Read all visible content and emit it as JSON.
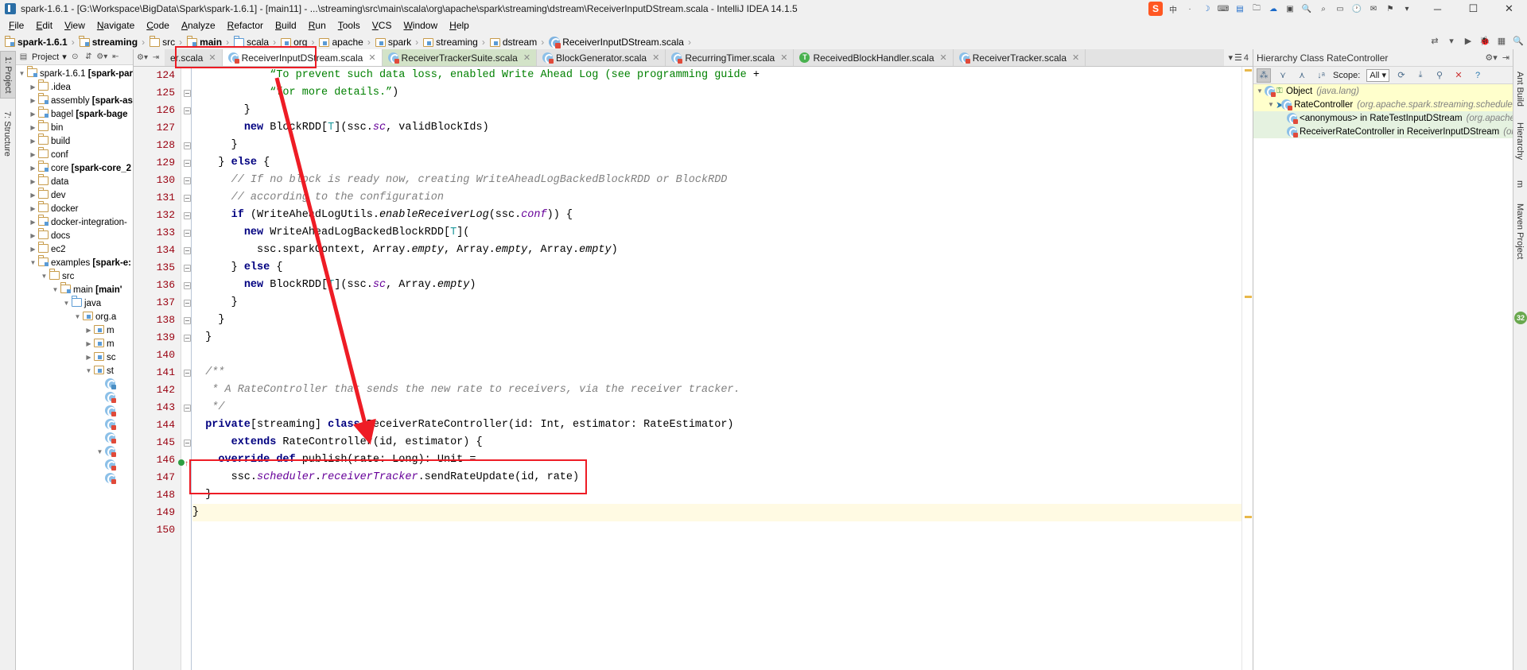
{
  "window": {
    "title": "spark-1.6.1 - [G:\\Workspace\\BigData\\Spark\\spark-1.6.1] - [main11] - ...\\streaming\\src\\main\\scala\\org\\apache\\spark\\streaming\\dstream\\ReceiverInputDStream.scala - IntelliJ IDEA 14.1.5",
    "minimize": "─",
    "maximize": "☐",
    "close": "✕"
  },
  "tray": {
    "sogou": "S",
    "items": [
      "中",
      "·",
      "◐",
      "✎",
      "⌨",
      "▤",
      "▶",
      "☁",
      "⚡",
      "⬇",
      "⚙",
      "◉",
      "✉",
      "⚑",
      "▭",
      "▾"
    ]
  },
  "menu": [
    "File",
    "Edit",
    "View",
    "Navigate",
    "Code",
    "Analyze",
    "Refactor",
    "Build",
    "Run",
    "Tools",
    "VCS",
    "Window",
    "Help"
  ],
  "breadcrumb": [
    {
      "label": "spark-1.6.1",
      "icon": "folder-module-icon",
      "bold": true
    },
    {
      "label": "streaming",
      "icon": "folder-module-icon",
      "bold": true
    },
    {
      "label": "src",
      "icon": "folder-icon",
      "bold": false
    },
    {
      "label": "main",
      "icon": "folder-module-icon",
      "bold": true
    },
    {
      "label": "scala",
      "icon": "folder-source-icon",
      "bold": false
    },
    {
      "label": "org",
      "icon": "package-icon",
      "bold": false
    },
    {
      "label": "apache",
      "icon": "package-icon",
      "bold": false
    },
    {
      "label": "spark",
      "icon": "package-icon",
      "bold": false
    },
    {
      "label": "streaming",
      "icon": "package-icon",
      "bold": false
    },
    {
      "label": "dstream",
      "icon": "package-icon",
      "bold": false
    },
    {
      "label": "ReceiverInputDStream.scala",
      "icon": "scala-class-icon",
      "bold": false
    }
  ],
  "left_tool_strip": [
    {
      "label": "1: Project",
      "active": true
    },
    {
      "label": "7: Structure",
      "active": false
    }
  ],
  "right_tool_strip": [
    {
      "label": "Ant Build"
    },
    {
      "label": "Hierarchy"
    },
    {
      "label": "m"
    },
    {
      "label": "Maven Project"
    }
  ],
  "project_panel": {
    "toolbar": {
      "title": "Project",
      "dropdown": "▾",
      "icons": [
        "target-icon",
        "collapse-icon",
        "gear-icon",
        "hide-icon"
      ]
    },
    "tree": [
      {
        "depth": 0,
        "arrow": "▼",
        "icon": "folder-module-icon",
        "label": "spark-1.6.1 ",
        "bold": "[spark-par"
      },
      {
        "depth": 1,
        "arrow": "▶",
        "icon": "folder-icon",
        "label": ".idea",
        "bold": ""
      },
      {
        "depth": 1,
        "arrow": "▶",
        "icon": "folder-module-icon",
        "label": "assembly ",
        "bold": "[spark-as"
      },
      {
        "depth": 1,
        "arrow": "▶",
        "icon": "folder-module-icon",
        "label": "bagel ",
        "bold": "[spark-bage"
      },
      {
        "depth": 1,
        "arrow": "▶",
        "icon": "folder-icon",
        "label": "bin",
        "bold": ""
      },
      {
        "depth": 1,
        "arrow": "▶",
        "icon": "folder-icon",
        "label": "build",
        "bold": ""
      },
      {
        "depth": 1,
        "arrow": "▶",
        "icon": "folder-icon",
        "label": "conf",
        "bold": ""
      },
      {
        "depth": 1,
        "arrow": "▶",
        "icon": "folder-module-icon",
        "label": "core ",
        "bold": "[spark-core_2"
      },
      {
        "depth": 1,
        "arrow": "▶",
        "icon": "folder-icon",
        "label": "data",
        "bold": ""
      },
      {
        "depth": 1,
        "arrow": "▶",
        "icon": "folder-icon",
        "label": "dev",
        "bold": ""
      },
      {
        "depth": 1,
        "arrow": "▶",
        "icon": "folder-icon",
        "label": "docker",
        "bold": ""
      },
      {
        "depth": 1,
        "arrow": "▶",
        "icon": "folder-module-icon",
        "label": "docker-integration-",
        "bold": ""
      },
      {
        "depth": 1,
        "arrow": "▶",
        "icon": "folder-icon",
        "label": "docs",
        "bold": ""
      },
      {
        "depth": 1,
        "arrow": "▶",
        "icon": "folder-icon",
        "label": "ec2",
        "bold": ""
      },
      {
        "depth": 1,
        "arrow": "▼",
        "icon": "folder-module-icon",
        "label": "examples ",
        "bold": "[spark-e:"
      },
      {
        "depth": 2,
        "arrow": "▼",
        "icon": "folder-icon",
        "label": "src",
        "bold": ""
      },
      {
        "depth": 3,
        "arrow": "▼",
        "icon": "folder-module-icon",
        "label": "main ",
        "bold": "[main'"
      },
      {
        "depth": 4,
        "arrow": "▼",
        "icon": "folder-source-icon",
        "label": "java",
        "bold": ""
      },
      {
        "depth": 5,
        "arrow": "▼",
        "icon": "package-icon",
        "label": "org.a",
        "bold": ""
      },
      {
        "depth": 6,
        "arrow": "▶",
        "icon": "package-icon",
        "label": "m",
        "bold": ""
      },
      {
        "depth": 6,
        "arrow": "▶",
        "icon": "package-icon",
        "label": "m",
        "bold": ""
      },
      {
        "depth": 6,
        "arrow": "▶",
        "icon": "package-icon",
        "label": "sc",
        "bold": ""
      },
      {
        "depth": 6,
        "arrow": "▼",
        "icon": "package-icon",
        "label": "st",
        "bold": ""
      },
      {
        "depth": 7,
        "arrow": "",
        "icon": "scala-object-icon",
        "label": "",
        "bold": ""
      },
      {
        "depth": 7,
        "arrow": "",
        "icon": "scala-class-icon",
        "label": "",
        "bold": ""
      },
      {
        "depth": 7,
        "arrow": "",
        "icon": "scala-class-icon",
        "label": "",
        "bold": ""
      },
      {
        "depth": 7,
        "arrow": "",
        "icon": "scala-class-icon",
        "label": "",
        "bold": ""
      },
      {
        "depth": 7,
        "arrow": "",
        "icon": "scala-class-icon",
        "label": "",
        "bold": ""
      },
      {
        "depth": 7,
        "arrow": "▼",
        "icon": "scala-class-icon",
        "label": "",
        "bold": ""
      },
      {
        "depth": 7,
        "arrow": "",
        "icon": "scala-class-icon",
        "label": "",
        "bold": ""
      },
      {
        "depth": 7,
        "arrow": "",
        "icon": "scala-class-icon",
        "label": "",
        "bold": ""
      }
    ]
  },
  "editor_tabs": {
    "tools": [
      "gear-icon",
      "locate-icon"
    ],
    "tabs": [
      {
        "label": "er.scala",
        "state": "normal",
        "icon": "scala-class-icon",
        "close": "✕"
      },
      {
        "label": "ReceiverInputDStream.scala",
        "state": "selected",
        "icon": "scala-class-icon",
        "close": "✕"
      },
      {
        "label": "ReceiverTrackerSuite.scala",
        "state": "green",
        "icon": "scala-class-icon",
        "close": "✕"
      },
      {
        "label": "BlockGenerator.scala",
        "state": "normal",
        "icon": "scala-class-icon",
        "close": "✕"
      },
      {
        "label": "RecurringTimer.scala",
        "state": "normal",
        "icon": "scala-class-icon",
        "close": "✕"
      },
      {
        "label": "ReceivedBlockHandler.scala",
        "state": "normal",
        "icon": "scala-test-icon",
        "close": "✕"
      },
      {
        "label": "ReceiverTracker.scala",
        "state": "normal",
        "icon": "scala-class-icon",
        "close": "✕"
      }
    ],
    "overflow": {
      "arrow": "▾",
      "icon": "☰",
      "count": "4"
    }
  },
  "code": {
    "first_line": 124,
    "current_line": 149,
    "lines": [
      {
        "no": 124,
        "fold": "none",
        "html": "            <s>“To prevent such data loss, enabled Write Ahead Log (see programming guide </s>+"
      },
      {
        "no": 125,
        "fold": "end",
        "html": "            <s>“for more details.”</s>)"
      },
      {
        "no": 126,
        "fold": "end",
        "html": "        }"
      },
      {
        "no": 127,
        "fold": "none",
        "html": "        <k>new</k> BlockRDD[<t>T</t>](ssc.<f>sc</f>, validBlockIds)"
      },
      {
        "no": 128,
        "fold": "end",
        "html": "      }"
      },
      {
        "no": 129,
        "fold": "open",
        "html": "    } <k>else</k> {"
      },
      {
        "no": 130,
        "fold": "open",
        "html": "      <c>// If no block is ready now, creating WriteAheadLogBackedBlockRDD or BlockRDD</c>"
      },
      {
        "no": 131,
        "fold": "end",
        "html": "      <c>// according to the configuration</c>"
      },
      {
        "no": 132,
        "fold": "open",
        "html": "      <k>if</k> (WriteAheadLogUtils.<i>enableReceiverLog</i>(ssc.<f>conf</f>)) {"
      },
      {
        "no": 133,
        "fold": "open",
        "html": "        <k>new</k> WriteAheadLogBackedBlockRDD[<t>T</t>]("
      },
      {
        "no": 134,
        "fold": "end",
        "html": "          ssc.sparkContext, Array.<i>empty</i>, Array.<i>empty</i>, Array.<i>empty</i>)"
      },
      {
        "no": 135,
        "fold": "open",
        "html": "      } <k>else</k> {"
      },
      {
        "no": 136,
        "fold": "end",
        "html": "        <k>new</k> BlockRDD[<t>T</t>](ssc.<f>sc</f>, Array.<i>empty</i>)"
      },
      {
        "no": 137,
        "fold": "end",
        "html": "      }"
      },
      {
        "no": 138,
        "fold": "end",
        "html": "    }"
      },
      {
        "no": 139,
        "fold": "end",
        "html": "  }"
      },
      {
        "no": 140,
        "fold": "none",
        "html": ""
      },
      {
        "no": 141,
        "fold": "open",
        "html": "  <c>/**</c>"
      },
      {
        "no": 142,
        "fold": "none",
        "html": "   <c>* A RateController that sends the new rate to receivers, via the receiver tracker.</c>"
      },
      {
        "no": 143,
        "fold": "end",
        "html": "   <c>*/</c>"
      },
      {
        "no": 144,
        "fold": "none",
        "html": "  <k>private</k>[streaming] <k>class</k> ReceiverRateController(id: Int, estimator: RateEstimator)"
      },
      {
        "no": 145,
        "fold": "end",
        "html": "      <k>extends</k> RateController(id, estimator) {"
      },
      {
        "no": 146,
        "fold": "none",
        "html": "    <k>override def</k> publish(rate: Long): Unit ="
      },
      {
        "no": 147,
        "fold": "none",
        "html": "      ssc.<f>scheduler</f>.<f>receiverTracker</f>.sendRateUpdate(id, rate)"
      },
      {
        "no": 148,
        "fold": "none",
        "html": "  }"
      },
      {
        "no": 149,
        "fold": "none",
        "html": "}"
      },
      {
        "no": 150,
        "fold": "none",
        "html": ""
      }
    ]
  },
  "annotations": {
    "tab_highlight_box": true,
    "code_highlight_box": true,
    "arrow_color": "#ee1c25",
    "box_color": "#ee1c25"
  },
  "hierarchy": {
    "title": "Hierarchy Class RateController",
    "head_icons": [
      "gear-icon",
      "hide-icon"
    ],
    "toolbar": {
      "buttons": [
        "subtypes-hierarchy-icon",
        "supertypes-hierarchy-icon",
        "subtypes-icon",
        "sort-alpha-icon"
      ],
      "scope_label": "Scope:",
      "scope_value": "All",
      "scope_arrow": "▾",
      "refresh_icon": "refresh-icon",
      "export_icon": "export-icon",
      "pin_icon": "pin-icon",
      "close_icon": "✕",
      "help_icon": "?"
    },
    "rows": [
      {
        "indent": 0,
        "arrow": "▼",
        "icon": "java-class-icon",
        "lock": true,
        "name": "Object",
        "pkg": "(java.lang)",
        "bg": "yellow"
      },
      {
        "indent": 1,
        "arrow": "▼",
        "icon": "scala-class-icon",
        "pointer": true,
        "name": "RateController",
        "pkg": "(org.apache.spark.streaming.scheduler)",
        "bg": "yellow"
      },
      {
        "indent": 2,
        "arrow": "",
        "icon": "scala-class-icon",
        "name": "<anonymous> in RateTestInputDStream",
        "pkg": "(org.apache.spark.s",
        "bg": "green"
      },
      {
        "indent": 2,
        "arrow": "",
        "icon": "scala-class-icon",
        "name": "ReceiverRateController in ReceiverInputDStream",
        "pkg": "(org.apache",
        "bg": "green"
      }
    ]
  }
}
